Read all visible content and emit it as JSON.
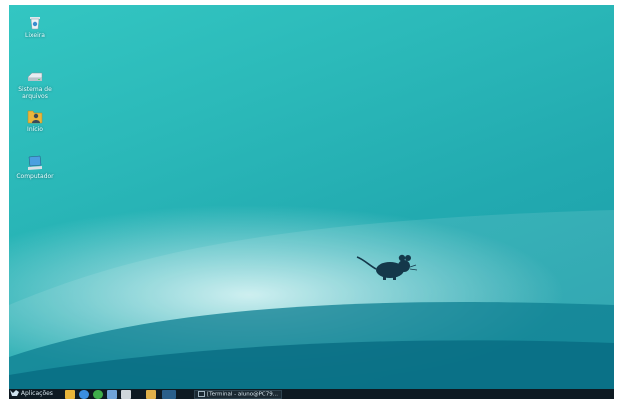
{
  "desktop": {
    "icons": [
      {
        "label": "Lixeira",
        "icon": "trash-icon"
      },
      {
        "label": "Sistema de arquivos",
        "icon": "drive-icon"
      },
      {
        "label": "Início",
        "icon": "home-folder-icon"
      },
      {
        "label": "Computador",
        "icon": "computer-icon"
      }
    ],
    "wallpaper": {
      "logo": "xfce-mouse-logo",
      "colors": [
        "#33c6c2",
        "#1a9aa8"
      ]
    }
  },
  "taskbar": {
    "menu_label": "Aplicações",
    "launchers": [
      {
        "icon": "file-manager-icon",
        "color": "#e8b53a"
      },
      {
        "icon": "settings-icon",
        "color": "#3a8ee0"
      },
      {
        "icon": "web-browser-icon",
        "color": "#3fae4a"
      },
      {
        "icon": "mail-icon",
        "color": "#6fa3d8"
      },
      {
        "icon": "terminal-icon",
        "color": "#cfd6da"
      },
      {
        "icon": "home-folder-icon",
        "color": "#e0b04a"
      },
      {
        "icon": "workspace-icon",
        "color": "#2a5f8a"
      }
    ],
    "window_button_label": "[Terminal - aluno@PC79..."
  }
}
